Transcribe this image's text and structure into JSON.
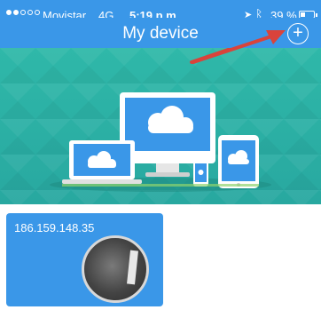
{
  "status_bar": {
    "signal_dots_filled": 2,
    "signal_dots_total": 5,
    "carrier": "Movistar",
    "network": "4G",
    "time": "5:19 p.m.",
    "battery": "39 %",
    "battery_level": 0.39,
    "location_icon": "location-arrow-icon",
    "bluetooth_icon": "bluetooth-icon"
  },
  "nav": {
    "title": "My device",
    "add_symbol": "+",
    "add_icon": "plus-circle-icon"
  },
  "colors": {
    "accent": "#3a97e8",
    "banner": "#2fb8a9",
    "arrow": "#d9433b"
  },
  "devices": [
    {
      "ip": "186.159.148.35"
    }
  ]
}
